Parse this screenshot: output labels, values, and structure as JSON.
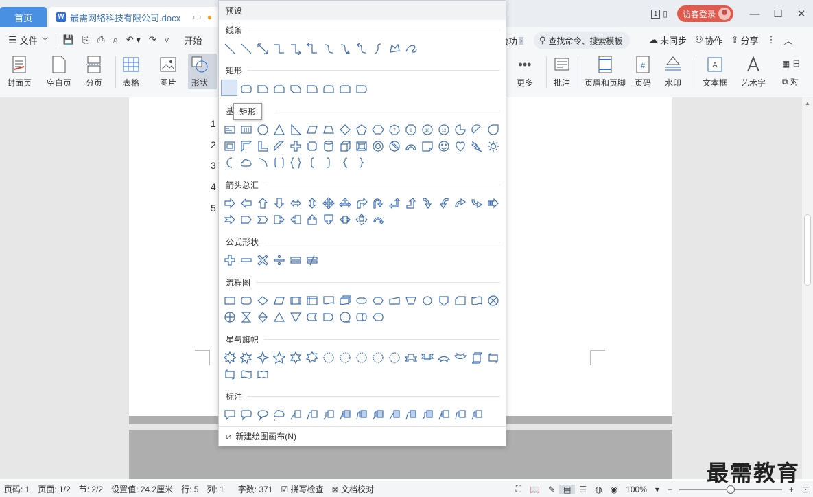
{
  "titlebar": {
    "home_tab": "首页",
    "doc_tab": "最需网络科技有限公司.docx",
    "unread_badge": "1",
    "login_label": "访客登录",
    "min": "—",
    "max": "☐",
    "close": "✕"
  },
  "menubar": {
    "file": "文件",
    "start": "开始",
    "partial_tab": "绘功",
    "search_placeholder": "查找命令、搜索模板",
    "sync": "未同步",
    "collab": "协作",
    "share": "分享"
  },
  "ribbon": {
    "cover": "封面页",
    "blank": "空白页",
    "pagebreak": "分页",
    "table": "表格",
    "picture": "图片",
    "shapes": "形状",
    "more": "更多",
    "comment": "批注",
    "header_footer": "页眉和页脚",
    "page_num": "页码",
    "watermark": "水印",
    "textbox": "文本框",
    "wordart": "艺术字",
    "date_partial": "日",
    "object_partial": "对"
  },
  "document": {
    "line_numbers": [
      "1",
      "2",
      "3",
      "4",
      "5"
    ]
  },
  "shape_panel": {
    "header": "预设",
    "sections": [
      {
        "title": "线条"
      },
      {
        "title": "矩形"
      },
      {
        "title": "基"
      },
      {
        "title": "箭头总汇"
      },
      {
        "title": "公式形状"
      },
      {
        "title": "流程图"
      },
      {
        "title": "星与旗帜"
      },
      {
        "title": "标注"
      }
    ],
    "tooltip": "矩形",
    "footer": "新建绘图画布(N)"
  },
  "statusbar": {
    "page": "页码: 1",
    "pages": "页面: 1/2",
    "section": "节: 2/2",
    "setting": "设置值: 24.2厘米",
    "row": "行: 5",
    "col": "列: 1",
    "words": "字数: 371",
    "spell": "拼写检查",
    "proof": "文档校对",
    "zoom": "100%",
    "zoom_level": 1.0
  },
  "watermark_text": "最需教育",
  "colors": {
    "accent": "#4a90e2",
    "shape_stroke": "#3f6fb5",
    "login": "#e05a4e"
  }
}
